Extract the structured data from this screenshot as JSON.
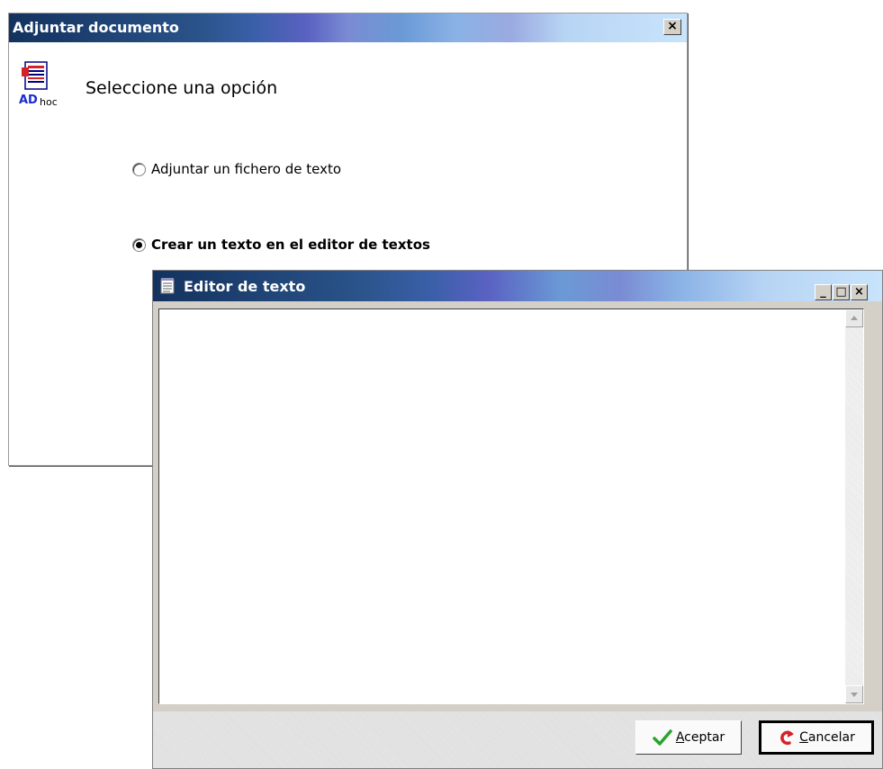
{
  "back_dialog": {
    "title": "Adjuntar documento",
    "close_glyph": "×",
    "icon": "adhoc-document-icon",
    "icon_caption": "ADhoc",
    "heading": "Seleccione una opción",
    "options": [
      {
        "label": "Adjuntar un fichero de texto",
        "checked": false
      },
      {
        "label": "Crear un texto en el editor de textos",
        "checked": true
      }
    ]
  },
  "editor": {
    "title": "Editor de texto",
    "icon": "notepad-icon",
    "window_buttons": {
      "minimize": "_",
      "maximize": "□",
      "close": "×"
    },
    "text_content": "",
    "buttons": {
      "accept": {
        "label": "Aceptar",
        "accesskey": "A",
        "label_rest": "ceptar",
        "icon": "checkmark-icon"
      },
      "cancel": {
        "label": "Cancelar",
        "accesskey": "C",
        "label_rest": "ancelar",
        "icon": "cancel-arrow-icon"
      }
    }
  },
  "colors": {
    "title_dark": "#13325e",
    "title_light": "#c8e4fc",
    "check_green": "#2aa52a",
    "cancel_red": "#d4222a",
    "face": "#d4d0c8"
  }
}
